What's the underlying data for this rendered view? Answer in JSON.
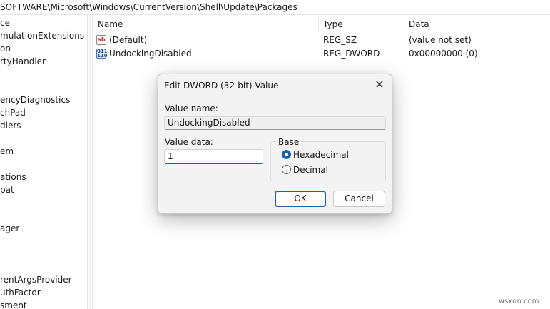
{
  "address": {
    "path": "SOFTWARE\\Microsoft\\Windows\\CurrentVersion\\Shell\\Update\\Packages"
  },
  "tree": {
    "items": [
      "ce",
      "mulationExtensions",
      "on",
      "rtyHandler",
      "encyDiagnostics",
      "chPad",
      "dlers",
      "em",
      "ations",
      "pat",
      "ager",
      "rentArgsProvider",
      "uthFactor",
      "sment"
    ]
  },
  "list": {
    "columns": {
      "name": "Name",
      "type": "Type",
      "data": "Data"
    },
    "rows": [
      {
        "icon": "string-value-icon",
        "icon_text": "ab",
        "name": "(Default)",
        "type": "REG_SZ",
        "data": "(value not set)"
      },
      {
        "icon": "binary-value-icon",
        "icon_text": "011 110",
        "name": "UndockingDisabled",
        "type": "REG_DWORD",
        "data": "0x00000000 (0)"
      }
    ]
  },
  "dialog": {
    "title": "Edit DWORD (32-bit) Value",
    "close_glyph": "✕",
    "value_name_label": "Value name:",
    "value_name": "UndockingDisabled",
    "value_data_label": "Value data:",
    "value_data": "1",
    "base_label": "Base",
    "base_options": [
      {
        "label": "Hexadecimal",
        "selected": true
      },
      {
        "label": "Decimal",
        "selected": false
      }
    ],
    "ok_label": "OK",
    "cancel_label": "Cancel",
    "accent_color": "#1f5ea8"
  },
  "watermark": "wsxdn.com"
}
